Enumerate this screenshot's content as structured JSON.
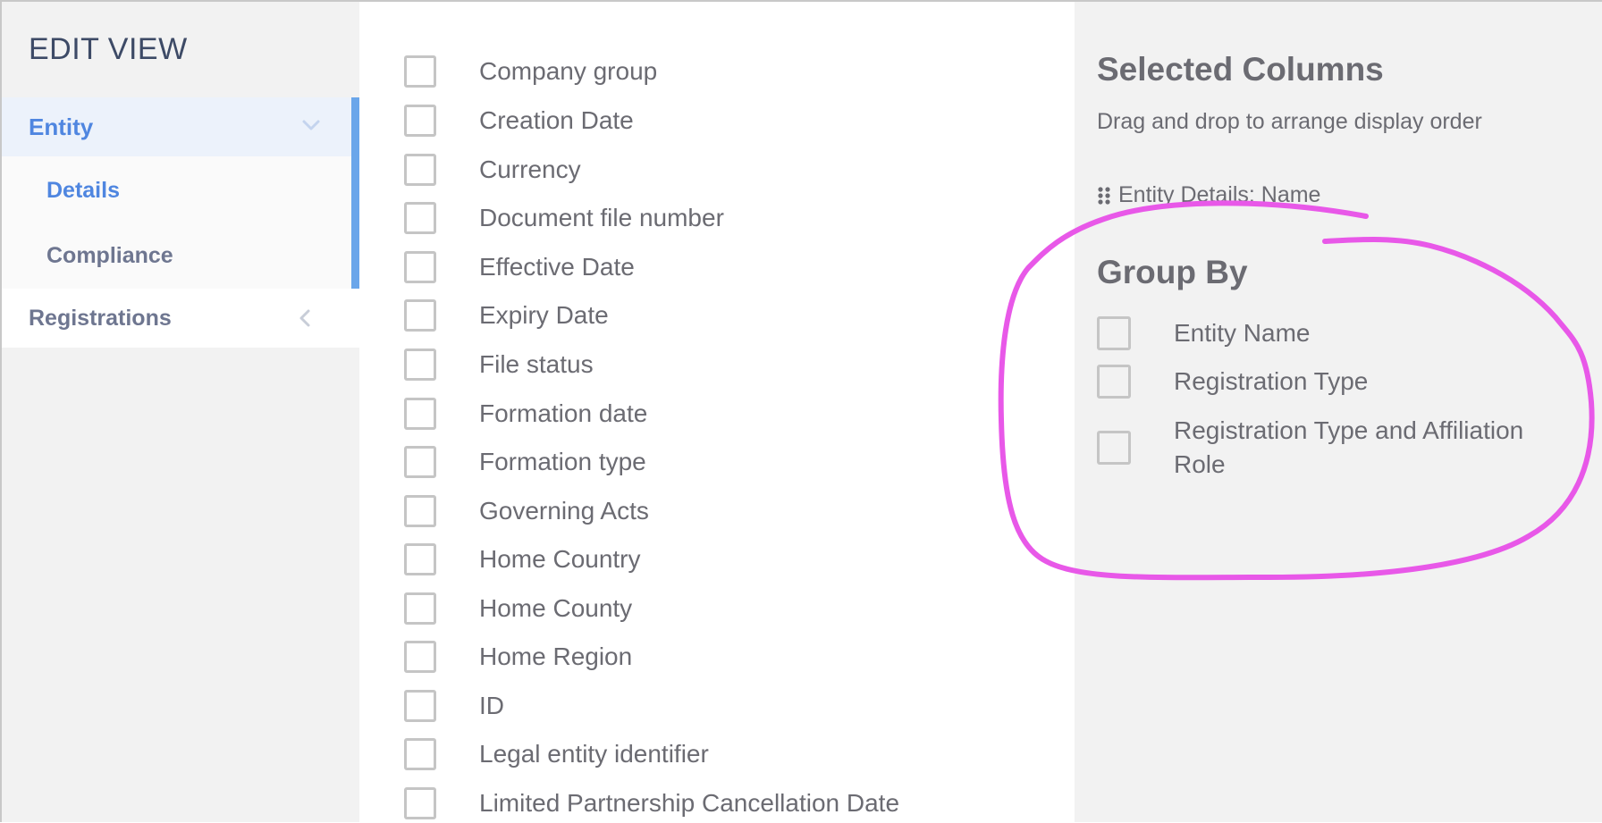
{
  "sidebar": {
    "title": "EDIT VIEW",
    "entity": {
      "label": "Entity",
      "icon": "chevron-down-icon"
    },
    "sub_items": [
      {
        "label": "Details"
      },
      {
        "label": "Compliance"
      }
    ],
    "registrations": {
      "label": "Registrations",
      "icon": "chevron-left-icon"
    }
  },
  "columns": [
    "Company group",
    "Creation Date",
    "Currency",
    "Document file number",
    "Effective Date",
    "Expiry Date",
    "File status",
    "Formation date",
    "Formation type",
    "Governing Acts",
    "Home Country",
    "Home County",
    "Home Region",
    "ID",
    "Legal entity identifier",
    "Limited Partnership Cancellation Date"
  ],
  "selected": {
    "title": "Selected Columns",
    "subtitle": "Drag and drop to arrange display order",
    "items": [
      "Entity Details: Name"
    ]
  },
  "group_by": {
    "title": "Group By",
    "options": [
      "Entity Name",
      "Registration Type",
      "Registration Type and Affiliation Role"
    ]
  },
  "colors": {
    "accent": "#4f86e0",
    "accent_bar": "#6aa6ea",
    "annotation": "#e858e8"
  }
}
